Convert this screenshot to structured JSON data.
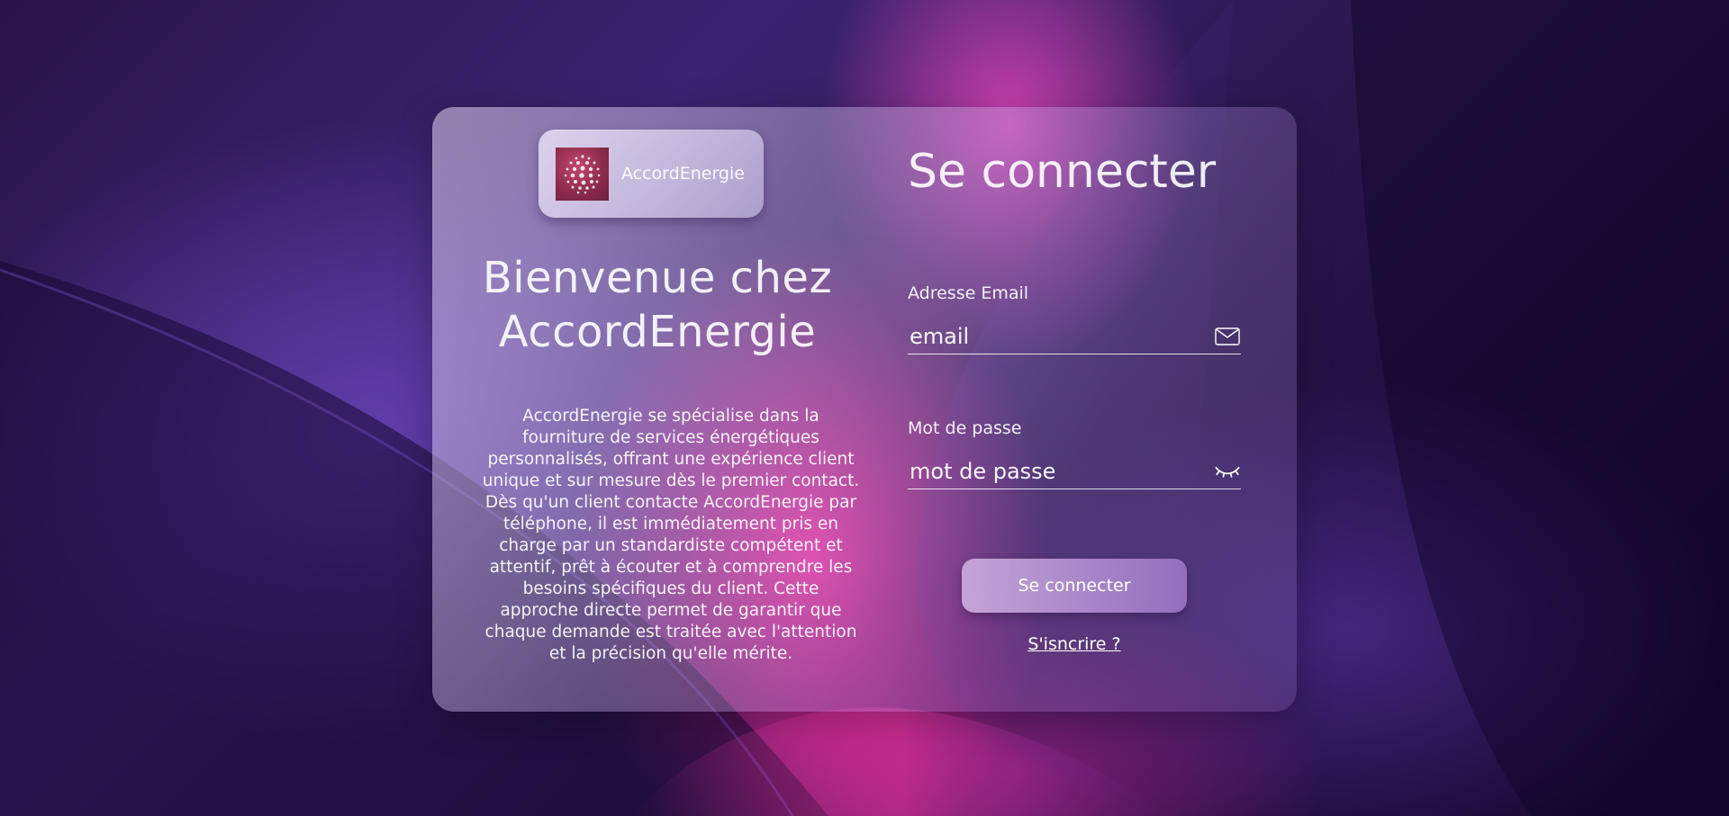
{
  "brand": {
    "name": "AccordEnergie",
    "logo_icon": "sphere-dots-logo",
    "logo_color": "#9a2f52"
  },
  "welcome": {
    "line1": "Bienvenue chez",
    "line2": "AccordEnergie"
  },
  "description": "AccordEnergie se spécialise dans la fourniture de services énergétiques personnalisés, offrant une expérience client unique et sur mesure dès le premier contact. Dès qu'un client contacte AccordEnergie par téléphone, il est immédiatement pris en charge par un standardiste compétent et attentif, prêt à écouter et à comprendre les besoins spécifiques du client. Cette approche directe permet de garantir que chaque demande est traitée avec l'attention et la précision qu'elle mérite.",
  "login": {
    "title": "Se connecter",
    "email": {
      "label": "Adresse Email",
      "placeholder": "email",
      "icon": "envelope-icon"
    },
    "password": {
      "label": "Mot de passe",
      "placeholder": "mot de passe",
      "icon": "eye-closed-icon"
    },
    "submit_label": "Se connecter",
    "signup_label": "S'isncrire ?"
  },
  "colors": {
    "accent_pink": "#ff2fa0",
    "deep_purple": "#1a0a35",
    "button": "#b894d4"
  }
}
